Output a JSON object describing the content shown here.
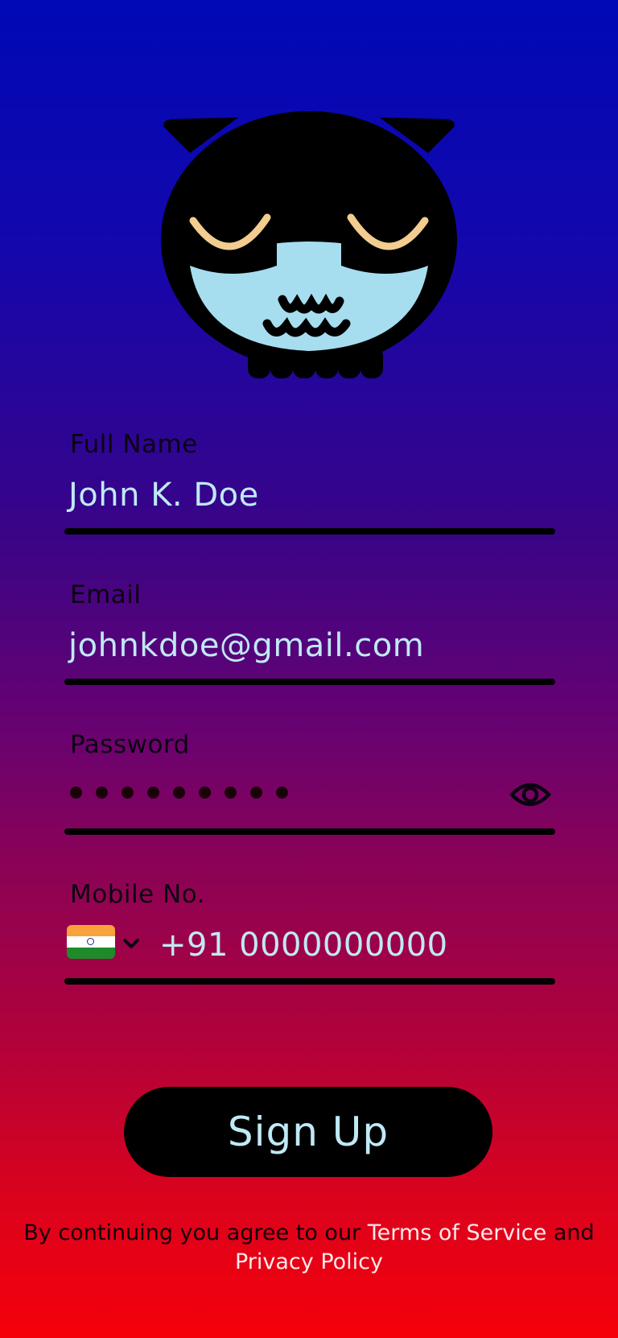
{
  "mascot": {
    "icon": "sleeping-owl-icon"
  },
  "form": {
    "full_name": {
      "label": "Full Name",
      "value": "John K. Doe"
    },
    "email": {
      "label": "Email",
      "value": "johnkdoe@gmail.com"
    },
    "password": {
      "label": "Password",
      "masked_length": 9,
      "toggle_icon": "eye-icon"
    },
    "mobile": {
      "label": "Mobile No.",
      "country_flag": "india-flag-icon",
      "value": "+91 0000000000"
    }
  },
  "signup_button": {
    "label": "Sign Up"
  },
  "terms": {
    "prefix": "By continuing you agree to our ",
    "terms_link": "Terms of Service",
    "middle": " and ",
    "privacy_link": "Privacy Policy"
  },
  "colors": {
    "gradient_top": "#0009b5",
    "gradient_bottom": "#f5000a",
    "input_text": "#bfe9f5",
    "button_bg": "#000000"
  }
}
